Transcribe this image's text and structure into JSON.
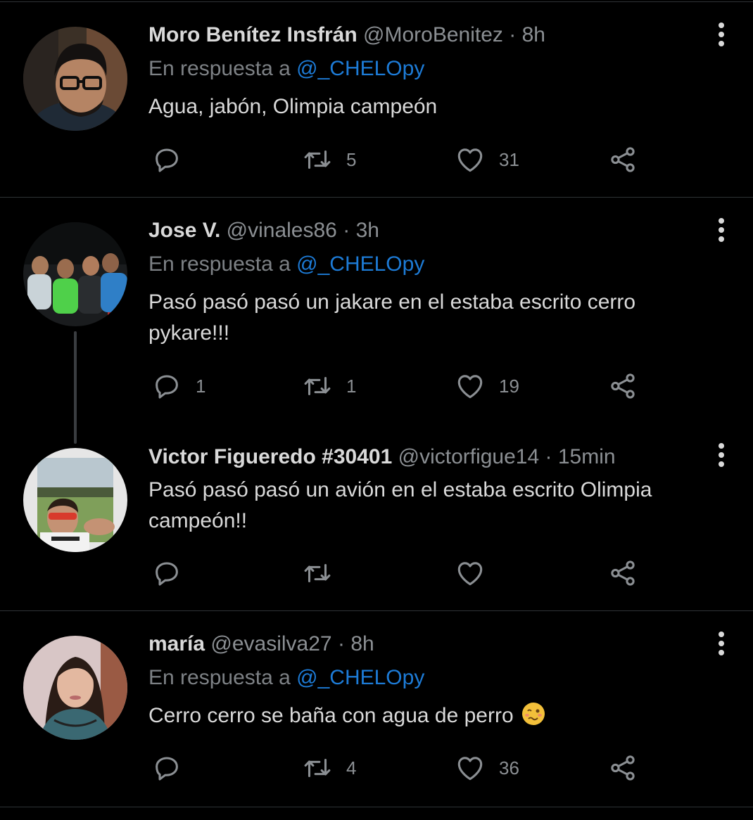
{
  "tweets": [
    {
      "name": "Moro Benítez Insfrán",
      "handle": "@MoroBenitez",
      "sep": "·",
      "time": "8h",
      "reply_prefix": "En respuesta a",
      "reply_to": "@_CHELOpy",
      "text": "Agua, jabón, Olimpia campeón",
      "replies": "",
      "retweets": "5",
      "likes": "31"
    },
    {
      "name": "Jose V.",
      "handle": "@vinales86",
      "sep": "·",
      "time": "3h",
      "reply_prefix": "En respuesta a",
      "reply_to": "@_CHELOpy",
      "text": "Pasó pasó pasó un jakare en el estaba escrito cerro pykare!!!",
      "replies": "1",
      "retweets": "1",
      "likes": "19"
    },
    {
      "name": "Victor Figueredo #30401",
      "handle": "@victorfigue14",
      "sep": "·",
      "time": "15min",
      "text": "Pasó pasó pasó un avión en el estaba escrito Olimpia campeón!!",
      "replies": "",
      "retweets": "",
      "likes": ""
    },
    {
      "name": "maría",
      "handle": "@evasilva27",
      "sep": "·",
      "time": "8h",
      "reply_prefix": "En respuesta a",
      "reply_to": "@_CHELOpy",
      "text": "Cerro cerro se baña con agua de perro",
      "emoji": "woozy-face-emoji",
      "replies": "",
      "retweets": "4",
      "likes": "36"
    }
  ],
  "icons": {
    "reply": "reply-icon",
    "retweet": "retweet-icon",
    "like": "heart-icon",
    "share": "share-icon",
    "more": "more-vertical-icon"
  },
  "colors": {
    "background": "#000000",
    "mention": "#1d7bd6",
    "secondary_text": "#8b8f93",
    "divider": "#2f3336"
  }
}
